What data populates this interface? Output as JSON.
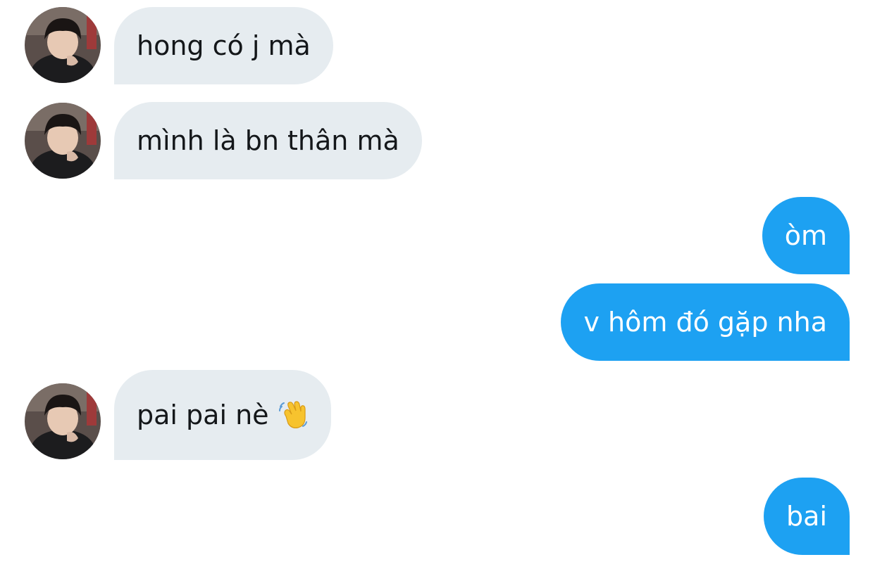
{
  "colors": {
    "incoming_bubble": "#e6ecf0",
    "outgoing_bubble": "#1da1f2",
    "incoming_text": "#14171a",
    "outgoing_text": "#ffffff"
  },
  "messages": [
    {
      "sender": "them",
      "text": "hong có j mà"
    },
    {
      "sender": "them",
      "text": "mình là bn thân mà"
    },
    {
      "sender": "me",
      "text": "òm"
    },
    {
      "sender": "me",
      "text": "v hôm đó gặp nha"
    },
    {
      "sender": "them",
      "text": "pai pai nè",
      "emoji": "waving-hand-icon"
    },
    {
      "sender": "me",
      "text": "bai"
    }
  ]
}
